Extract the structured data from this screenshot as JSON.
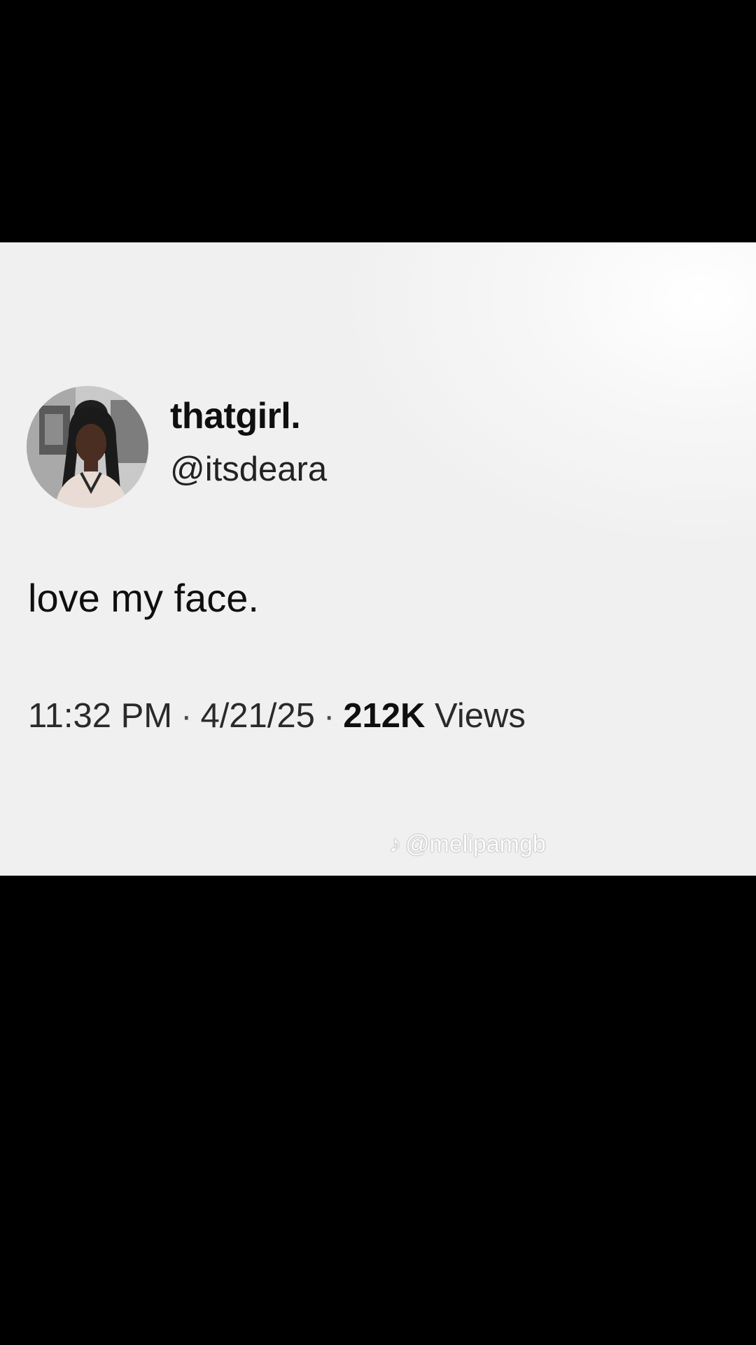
{
  "post": {
    "display_name": "thatgirl.",
    "handle": "@itsdeara",
    "text": "love my face.",
    "time": "11:32 PM",
    "separator": "·",
    "date": "4/21/25",
    "views_count": "212K",
    "views_label": "Views"
  },
  "avatar": {
    "icon": "profile-photo"
  },
  "watermark": {
    "icon": "tiktok-logo",
    "text": "@melipamgb"
  },
  "colors": {
    "card_background": "#f0f0f0",
    "letterbox": "#000000",
    "text_primary": "#0f0f0f"
  }
}
